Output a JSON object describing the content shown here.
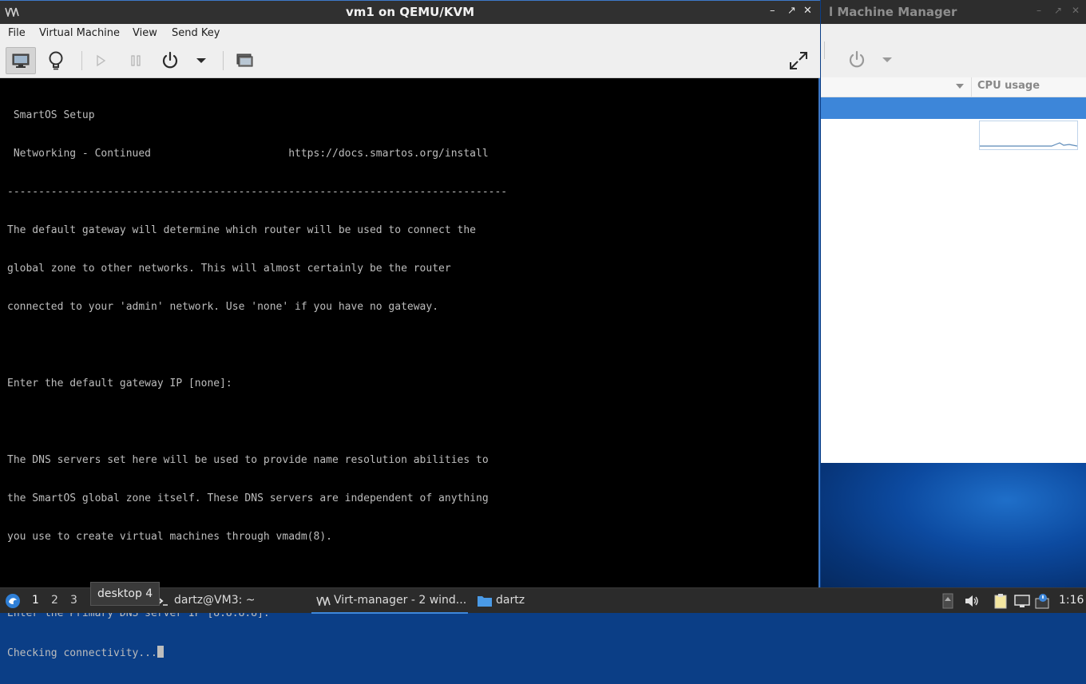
{
  "background_window": {
    "title": "l Machine Manager",
    "column_header": "CPU usage"
  },
  "vm_window": {
    "title": "vm1 on QEMU/KVM",
    "menu": [
      "File",
      "Virtual Machine",
      "View",
      "Send Key"
    ],
    "toolbar": {
      "icons": [
        "console-icon",
        "details-icon",
        "run-icon",
        "pause-icon",
        "power-icon",
        "dropdown-arrow-icon",
        "snapshots-icon",
        "fullscreen-icon"
      ]
    },
    "console": {
      "lines": [
        " SmartOS Setup",
        " Networking - Continued                      https://docs.smartos.org/install",
        "--------------------------------------------------------------------------------",
        "The default gateway will determine which router will be used to connect the",
        "global zone to other networks. This will almost certainly be the router",
        "connected to your 'admin' network. Use 'none' if you have no gateway.",
        "",
        "Enter the default gateway IP [none]:",
        "",
        "The DNS servers set here will be used to provide name resolution abilities to",
        "the SmartOS global zone itself. These DNS servers are independent of anything",
        "you use to create virtual machines through vmadm(8).",
        "",
        "Enter the Primary DNS server IP [8.8.8.8]:"
      ],
      "prompt_line": "Checking connectivity..."
    }
  },
  "taskbar": {
    "workspaces": [
      "1",
      "2",
      "3"
    ],
    "tooltip": "desktop 4",
    "tasks": {
      "terminal": "dartz@VM3: ~",
      "virt_manager": "Virt-manager - 2 wind...",
      "file_manager": "dartz"
    },
    "clock": "1:16"
  },
  "colors": {
    "accent": "#3d86d9",
    "terminal_text": "#bdbdbd",
    "titlebar": "#303030"
  }
}
